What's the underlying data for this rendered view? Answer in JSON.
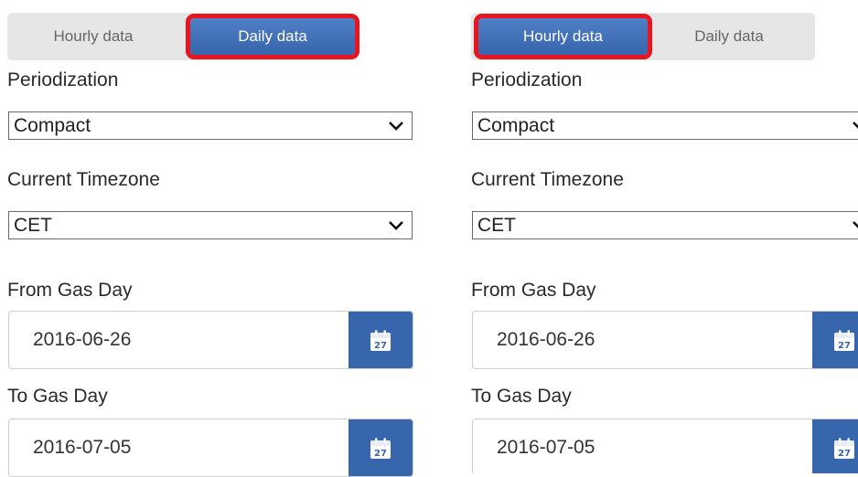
{
  "panels": [
    {
      "tabs": [
        {
          "label": "Hourly data",
          "active": false
        },
        {
          "label": "Daily data",
          "active": true
        }
      ],
      "periodization": {
        "label": "Periodization",
        "value": "Compact"
      },
      "timezone": {
        "label": "Current Timezone",
        "value": "CET"
      },
      "from": {
        "label": "From Gas Day",
        "value": "2016-06-26"
      },
      "to": {
        "label": "To Gas Day",
        "value": "2016-07-05"
      }
    },
    {
      "tabs": [
        {
          "label": "Hourly data",
          "active": true
        },
        {
          "label": "Daily data",
          "active": false
        }
      ],
      "periodization": {
        "label": "Periodization",
        "value": "Compact"
      },
      "timezone": {
        "label": "Current Timezone",
        "value": "CET"
      },
      "from": {
        "label": "From Gas Day",
        "value": "2016-06-26"
      },
      "to": {
        "label": "To Gas Day",
        "value": "2016-07-05"
      }
    }
  ],
  "calendar_day": "27",
  "colors": {
    "accent": "#3766ad",
    "highlight": "#e8141e",
    "tab_bg": "#e6e6e6"
  },
  "icons": {
    "dropdown": "chevron-down-icon",
    "calendar": "calendar-icon"
  }
}
